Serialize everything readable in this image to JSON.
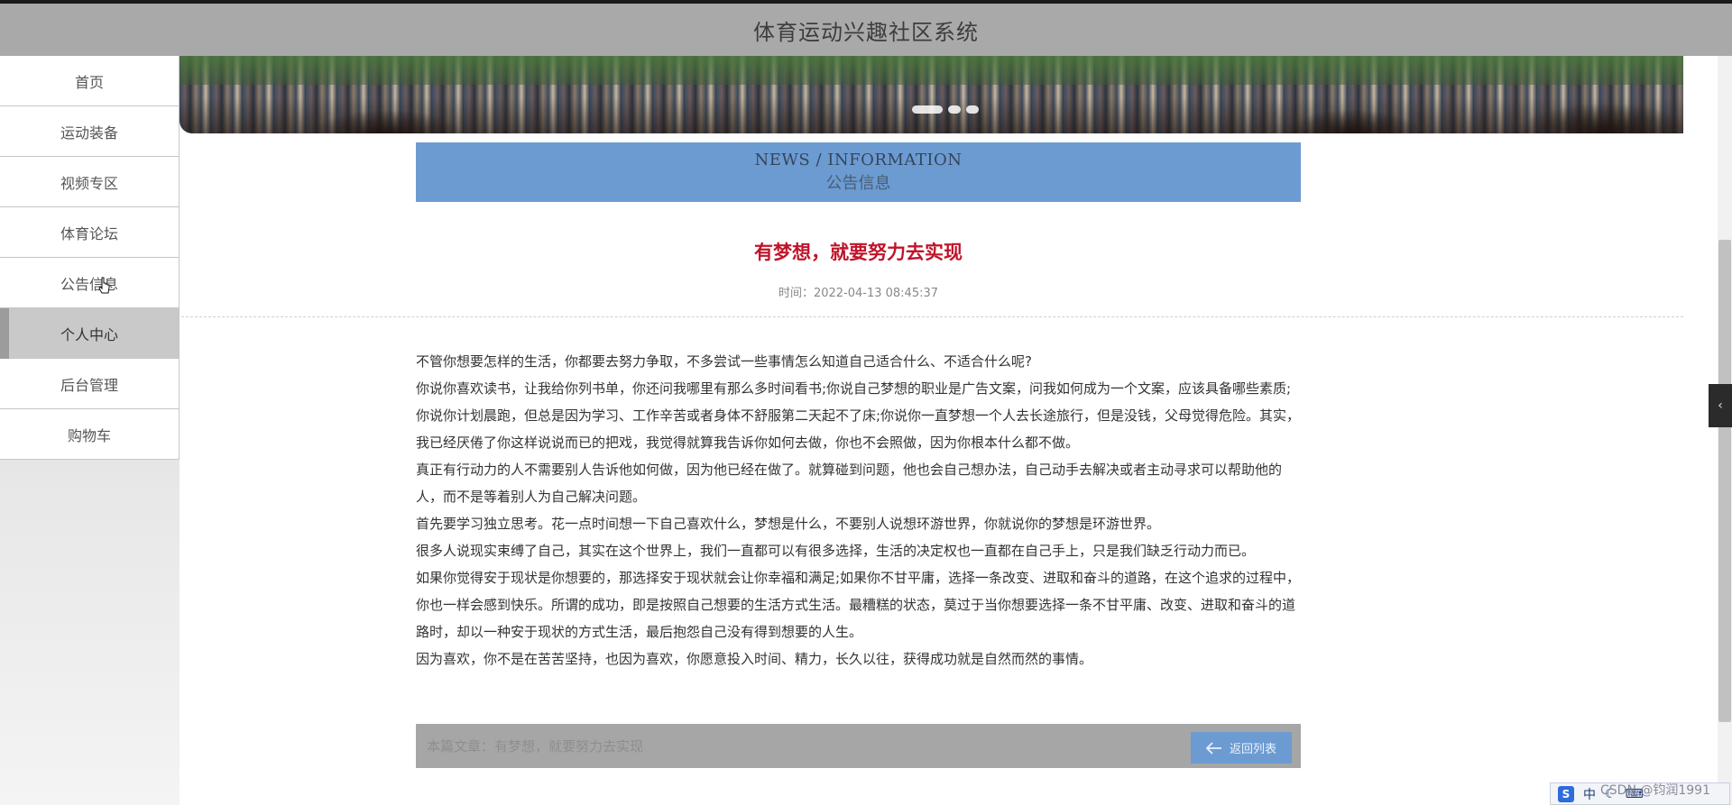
{
  "app": {
    "title": "体育运动兴趣社区系统"
  },
  "sidebar": {
    "items": [
      {
        "label": "首页"
      },
      {
        "label": "运动装备"
      },
      {
        "label": "视频专区"
      },
      {
        "label": "体育论坛"
      },
      {
        "label": "公告信息"
      },
      {
        "label": "个人中心",
        "active": true
      },
      {
        "label": "后台管理"
      },
      {
        "label": "购物车"
      }
    ]
  },
  "news_header": {
    "en": "NEWS / INFORMATION",
    "cn": "公告信息"
  },
  "article": {
    "title": "有梦想，就要努力去实现",
    "time": "时间：2022-04-13 08:45:37",
    "paragraphs": [
      "不管你想要怎样的生活，你都要去努力争取，不多尝试一些事情怎么知道自己适合什么、不适合什么呢?",
      "你说你喜欢读书，让我给你列书单，你还问我哪里有那么多时间看书;你说自己梦想的职业是广告文案，问我如何成为一个文案，应该具备哪些素质;你说你计划晨跑，但总是因为学习、工作辛苦或者身体不舒服第二天起不了床;你说你一直梦想一个人去长途旅行，但是没钱，父母觉得危险。其实，我已经厌倦了你这样说说而已的把戏，我觉得就算我告诉你如何去做，你也不会照做，因为你根本什么都不做。",
      "真正有行动力的人不需要别人告诉他如何做，因为他已经在做了。就算碰到问题，他也会自己想办法，自己动手去解决或者主动寻求可以帮助他的人，而不是等着别人为自己解决问题。",
      "首先要学习独立思考。花一点时间想一下自己喜欢什么，梦想是什么，不要别人说想环游世界，你就说你的梦想是环游世界。",
      "很多人说现实束缚了自己，其实在这个世界上，我们一直都可以有很多选择，生活的决定权也一直都在自己手上，只是我们缺乏行动力而已。",
      "如果你觉得安于现状是你想要的，那选择安于现状就会让你幸福和满足;如果你不甘平庸，选择一条改变、进取和奋斗的道路，在这个追求的过程中，你也一样会感到快乐。所谓的成功，即是按照自己想要的生活方式生活。最糟糕的状态，莫过于当你想要选择一条不甘平庸、改变、进取和奋斗的道路时，却以一种安于现状的方式生活，最后抱怨自己没有得到想要的人生。",
      "因为喜欢，你不是在苦苦坚持，也因为喜欢，你愿意投入时间、精力，长久以往，获得成功就是自然而然的事情。"
    ]
  },
  "footer_nav": {
    "prev_text": "本篇文章：有梦想，就要努力去实现",
    "back_label": "返回列表"
  },
  "side_tab": {
    "glyph": "‹"
  },
  "ime": {
    "lang": "中"
  },
  "watermark": "CSDN @钧润1991",
  "colors": {
    "accent": "#6c9bd2",
    "title_red": "#c0142a",
    "header_bg": "#a9a9a9"
  }
}
